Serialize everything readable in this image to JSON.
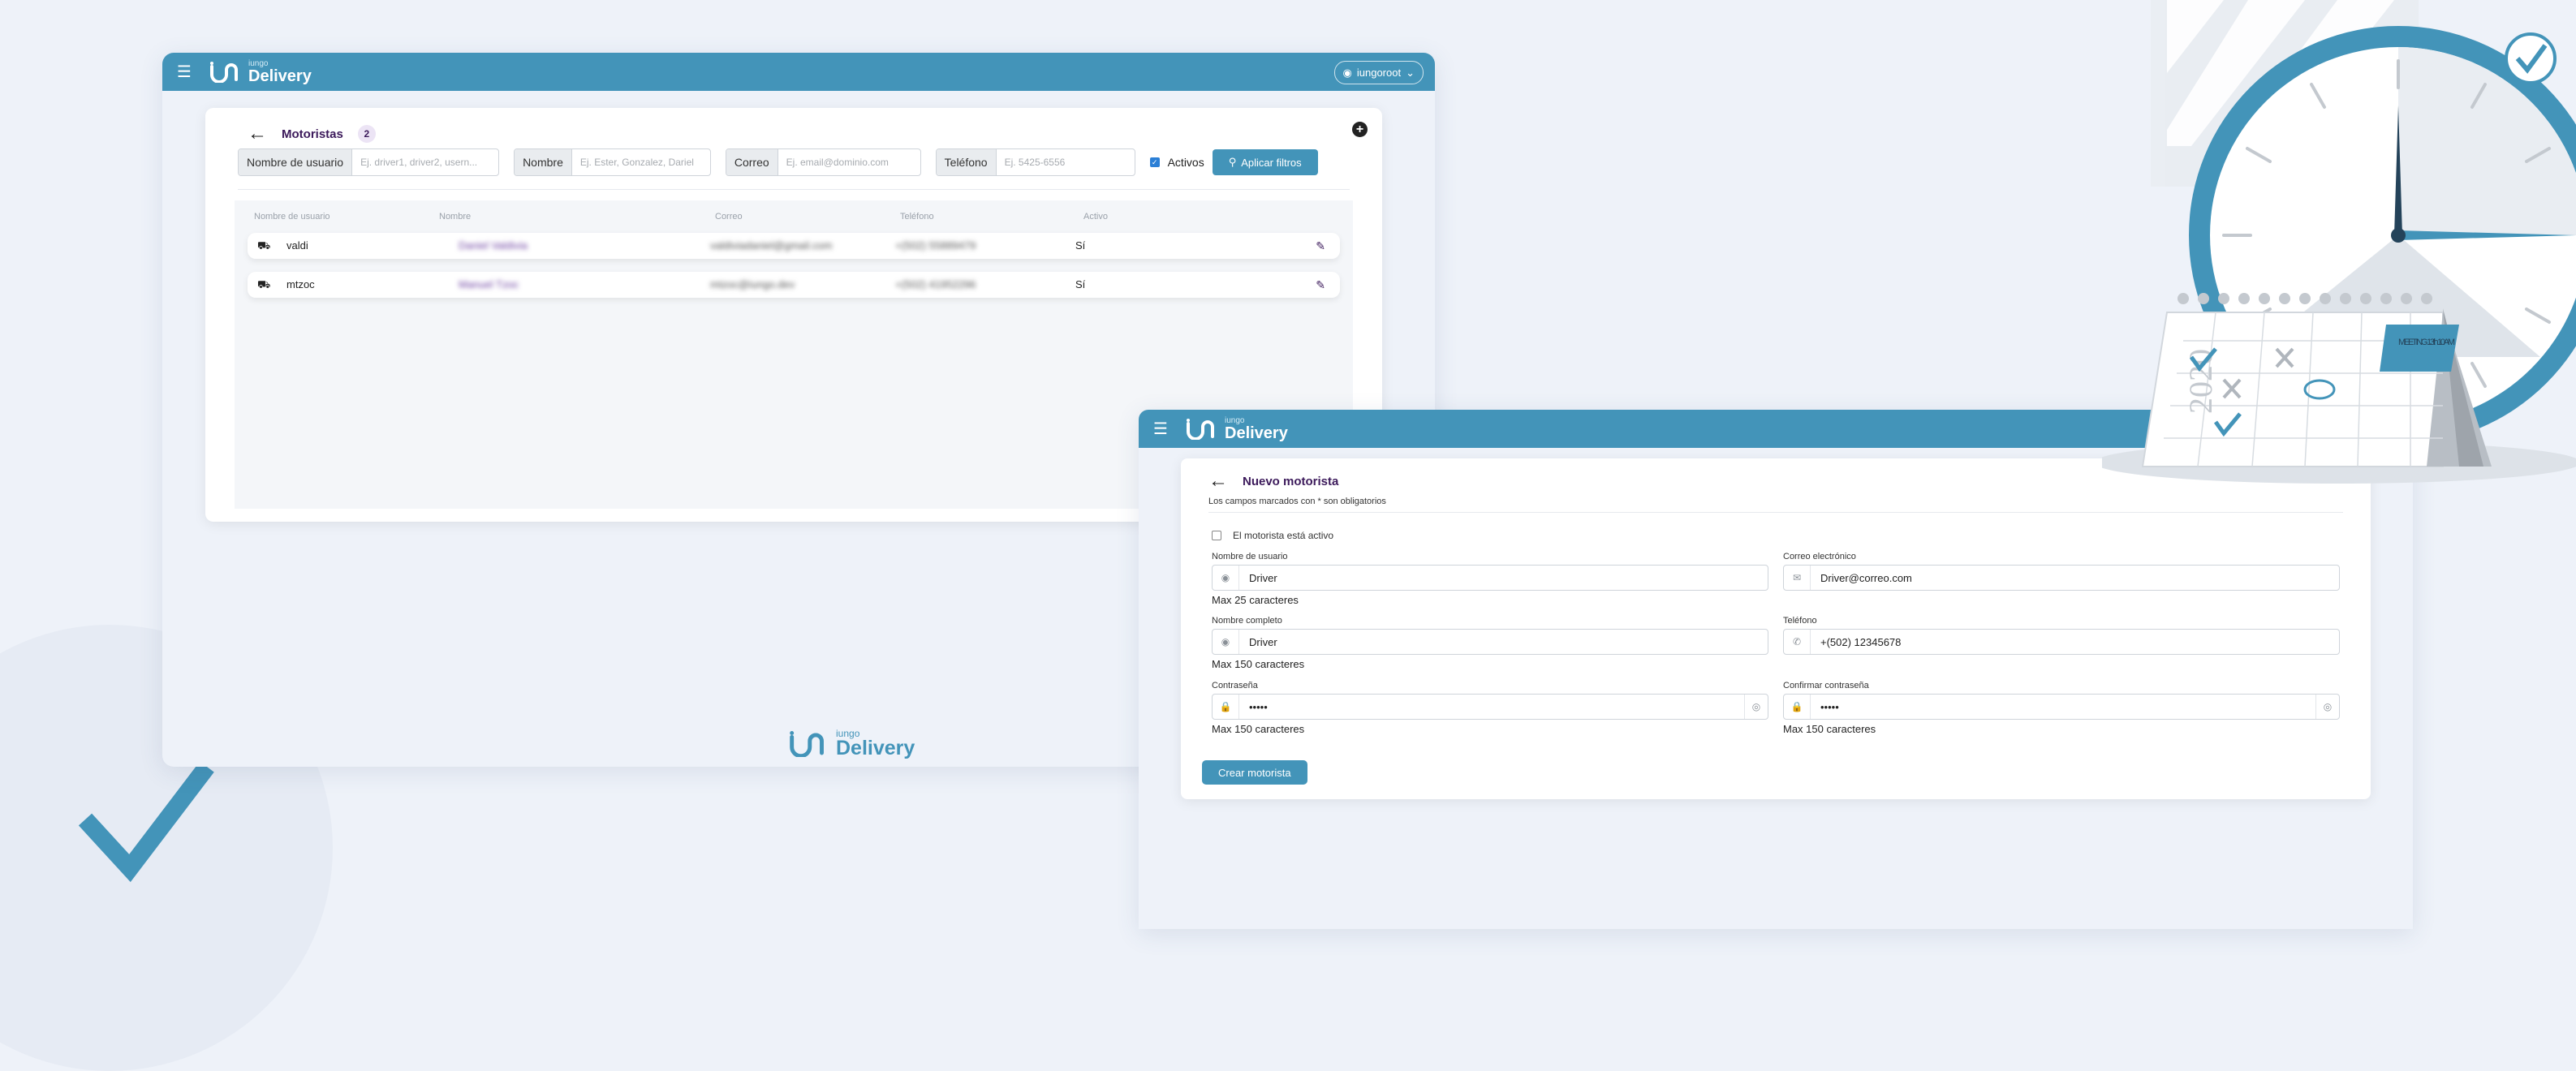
{
  "colors": {
    "brand": "#4394b9",
    "title_purple": "#3c1a5b",
    "background": "#eef2f9"
  },
  "brand": {
    "small": "iungo",
    "big": "Delivery"
  },
  "topbar": {
    "menu_icon": "hamburger-icon",
    "user": "iungoroot"
  },
  "list": {
    "title": "Motoristas",
    "count": "2",
    "filters": {
      "username": {
        "label": "Nombre de usuario",
        "placeholder": "Ej. driver1, driver2, usern..."
      },
      "name": {
        "label": "Nombre",
        "placeholder": "Ej. Ester, Gonzalez, Dariel"
      },
      "email": {
        "label": "Correo",
        "placeholder": "Ej. email@dominio.com"
      },
      "phone": {
        "label": "Teléfono",
        "placeholder": "Ej. 5425-6556"
      },
      "active_label": "Activos",
      "apply": "Aplicar filtros"
    },
    "columns": [
      "Nombre de usuario",
      "Nombre",
      "Correo",
      "Teléfono",
      "Activo"
    ],
    "rows": [
      {
        "username": "valdi",
        "name": "Daniel Valdivia",
        "email": "valdiviadaniel@gmail.com",
        "phone": "+(502) 55889479",
        "active": "Sí"
      },
      {
        "username": "mtzoc",
        "name": "Manuel Tzoc",
        "email": "mtzoc@iungo.dev",
        "phone": "+(502) 41952296",
        "active": "Sí"
      }
    ]
  },
  "form": {
    "title": "Nuevo motorista",
    "subtitle": "Los campos marcados con * son obligatorios",
    "active_label": "El motorista está activo",
    "username": {
      "label": "Nombre de usuario",
      "value": "Driver",
      "help": "Max 25 caracteres"
    },
    "email": {
      "label": "Correo electrónico",
      "value": "Driver@correo.com"
    },
    "fullname": {
      "label": "Nombre completo",
      "value": "Driver",
      "help": "Max 150 caracteres"
    },
    "phone": {
      "label": "Teléfono",
      "value": "+(502) 12345678"
    },
    "password": {
      "label": "Contraseña",
      "value": "•••••",
      "help": "Max 150 caracteres"
    },
    "confirm": {
      "label": "Confirmar contraseña",
      "value": "•••••",
      "help": "Max 150 caracteres"
    },
    "submit": "Crear motorista"
  },
  "decoration": {
    "calendar_note": "MEETING 13th 10AM",
    "calendar_year": "2020"
  }
}
